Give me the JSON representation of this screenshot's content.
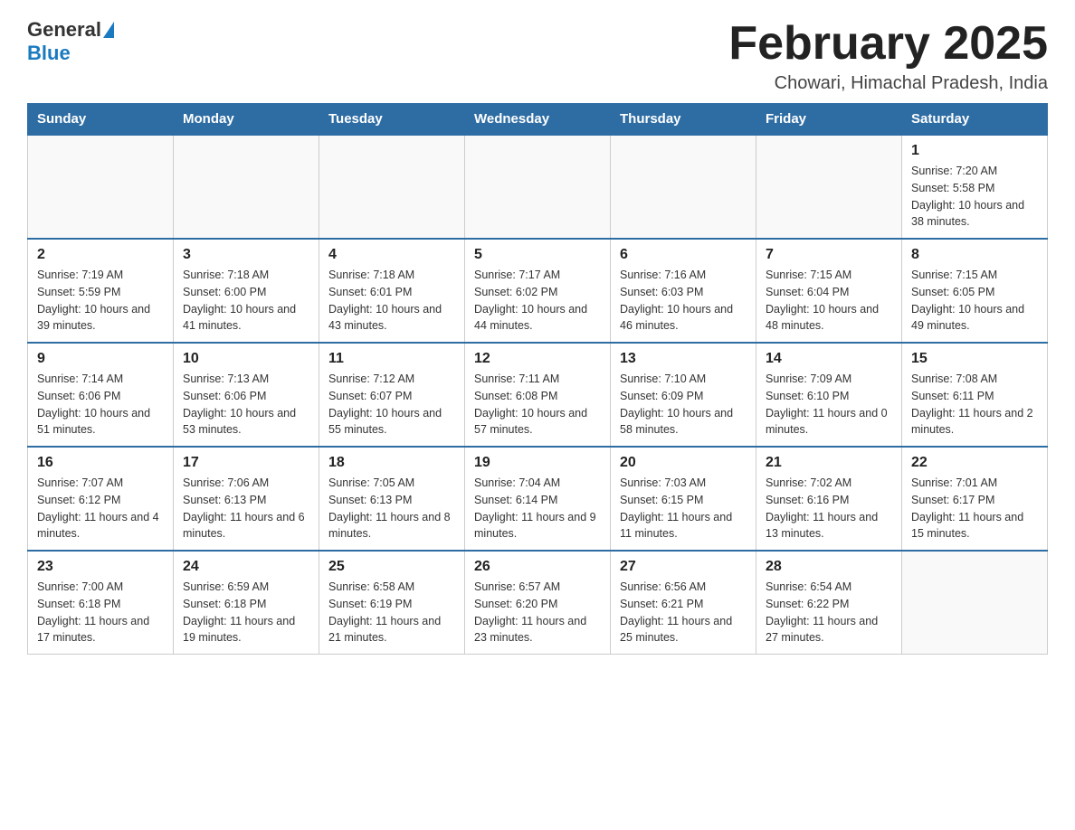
{
  "header": {
    "logo": {
      "text_general": "General",
      "text_blue": "Blue"
    },
    "title": "February 2025",
    "location": "Chowari, Himachal Pradesh, India"
  },
  "days_of_week": [
    "Sunday",
    "Monday",
    "Tuesday",
    "Wednesday",
    "Thursday",
    "Friday",
    "Saturday"
  ],
  "weeks": [
    [
      {
        "day": "",
        "info": ""
      },
      {
        "day": "",
        "info": ""
      },
      {
        "day": "",
        "info": ""
      },
      {
        "day": "",
        "info": ""
      },
      {
        "day": "",
        "info": ""
      },
      {
        "day": "",
        "info": ""
      },
      {
        "day": "1",
        "info": "Sunrise: 7:20 AM\nSunset: 5:58 PM\nDaylight: 10 hours and 38 minutes."
      }
    ],
    [
      {
        "day": "2",
        "info": "Sunrise: 7:19 AM\nSunset: 5:59 PM\nDaylight: 10 hours and 39 minutes."
      },
      {
        "day": "3",
        "info": "Sunrise: 7:18 AM\nSunset: 6:00 PM\nDaylight: 10 hours and 41 minutes."
      },
      {
        "day": "4",
        "info": "Sunrise: 7:18 AM\nSunset: 6:01 PM\nDaylight: 10 hours and 43 minutes."
      },
      {
        "day": "5",
        "info": "Sunrise: 7:17 AM\nSunset: 6:02 PM\nDaylight: 10 hours and 44 minutes."
      },
      {
        "day": "6",
        "info": "Sunrise: 7:16 AM\nSunset: 6:03 PM\nDaylight: 10 hours and 46 minutes."
      },
      {
        "day": "7",
        "info": "Sunrise: 7:15 AM\nSunset: 6:04 PM\nDaylight: 10 hours and 48 minutes."
      },
      {
        "day": "8",
        "info": "Sunrise: 7:15 AM\nSunset: 6:05 PM\nDaylight: 10 hours and 49 minutes."
      }
    ],
    [
      {
        "day": "9",
        "info": "Sunrise: 7:14 AM\nSunset: 6:06 PM\nDaylight: 10 hours and 51 minutes."
      },
      {
        "day": "10",
        "info": "Sunrise: 7:13 AM\nSunset: 6:06 PM\nDaylight: 10 hours and 53 minutes."
      },
      {
        "day": "11",
        "info": "Sunrise: 7:12 AM\nSunset: 6:07 PM\nDaylight: 10 hours and 55 minutes."
      },
      {
        "day": "12",
        "info": "Sunrise: 7:11 AM\nSunset: 6:08 PM\nDaylight: 10 hours and 57 minutes."
      },
      {
        "day": "13",
        "info": "Sunrise: 7:10 AM\nSunset: 6:09 PM\nDaylight: 10 hours and 58 minutes."
      },
      {
        "day": "14",
        "info": "Sunrise: 7:09 AM\nSunset: 6:10 PM\nDaylight: 11 hours and 0 minutes."
      },
      {
        "day": "15",
        "info": "Sunrise: 7:08 AM\nSunset: 6:11 PM\nDaylight: 11 hours and 2 minutes."
      }
    ],
    [
      {
        "day": "16",
        "info": "Sunrise: 7:07 AM\nSunset: 6:12 PM\nDaylight: 11 hours and 4 minutes."
      },
      {
        "day": "17",
        "info": "Sunrise: 7:06 AM\nSunset: 6:13 PM\nDaylight: 11 hours and 6 minutes."
      },
      {
        "day": "18",
        "info": "Sunrise: 7:05 AM\nSunset: 6:13 PM\nDaylight: 11 hours and 8 minutes."
      },
      {
        "day": "19",
        "info": "Sunrise: 7:04 AM\nSunset: 6:14 PM\nDaylight: 11 hours and 9 minutes."
      },
      {
        "day": "20",
        "info": "Sunrise: 7:03 AM\nSunset: 6:15 PM\nDaylight: 11 hours and 11 minutes."
      },
      {
        "day": "21",
        "info": "Sunrise: 7:02 AM\nSunset: 6:16 PM\nDaylight: 11 hours and 13 minutes."
      },
      {
        "day": "22",
        "info": "Sunrise: 7:01 AM\nSunset: 6:17 PM\nDaylight: 11 hours and 15 minutes."
      }
    ],
    [
      {
        "day": "23",
        "info": "Sunrise: 7:00 AM\nSunset: 6:18 PM\nDaylight: 11 hours and 17 minutes."
      },
      {
        "day": "24",
        "info": "Sunrise: 6:59 AM\nSunset: 6:18 PM\nDaylight: 11 hours and 19 minutes."
      },
      {
        "day": "25",
        "info": "Sunrise: 6:58 AM\nSunset: 6:19 PM\nDaylight: 11 hours and 21 minutes."
      },
      {
        "day": "26",
        "info": "Sunrise: 6:57 AM\nSunset: 6:20 PM\nDaylight: 11 hours and 23 minutes."
      },
      {
        "day": "27",
        "info": "Sunrise: 6:56 AM\nSunset: 6:21 PM\nDaylight: 11 hours and 25 minutes."
      },
      {
        "day": "28",
        "info": "Sunrise: 6:54 AM\nSunset: 6:22 PM\nDaylight: 11 hours and 27 minutes."
      },
      {
        "day": "",
        "info": ""
      }
    ]
  ]
}
